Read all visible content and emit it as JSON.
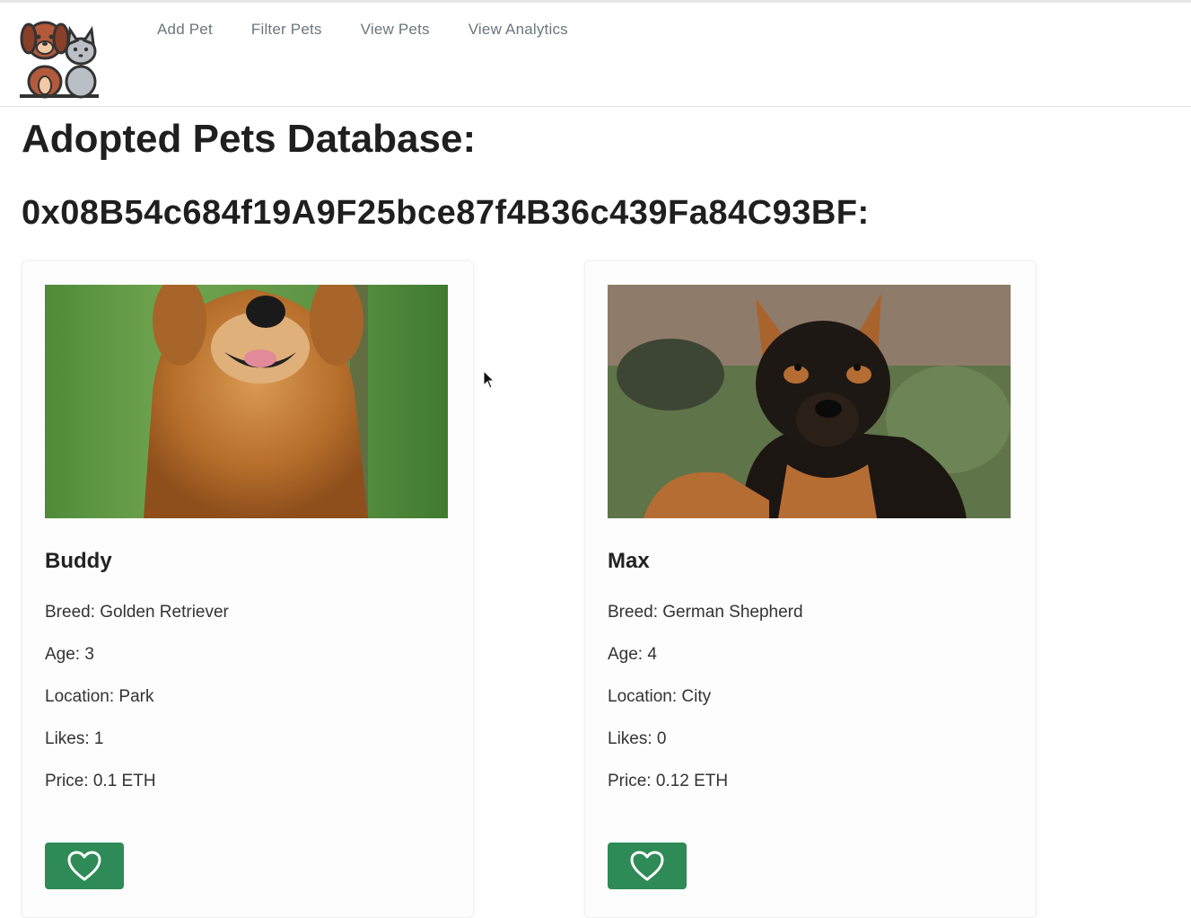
{
  "nav": {
    "links": [
      "Add Pet",
      "Filter Pets",
      "View Pets",
      "View Analytics"
    ]
  },
  "page": {
    "title": "Adopted Pets Database:",
    "address": "0x08B54c684f19A9F25bce87f4B36c439Fa84C93BF:"
  },
  "pets": [
    {
      "name": "Buddy",
      "breed": "Breed: Golden Retriever",
      "age": "Age: 3",
      "location": "Location: Park",
      "likes": "Likes: 1",
      "price": "Price: 0.1 ETH"
    },
    {
      "name": "Max",
      "breed": "Breed: German Shepherd",
      "age": "Age: 4",
      "location": "Location: City",
      "likes": "Likes: 0",
      "price": "Price: 0.12 ETH"
    }
  ],
  "colors": {
    "like_button": "#2e8b57",
    "nav_link": "#6c757d"
  },
  "icons": {
    "like": "heart-icon",
    "logo": "dog-and-cat-logo"
  }
}
